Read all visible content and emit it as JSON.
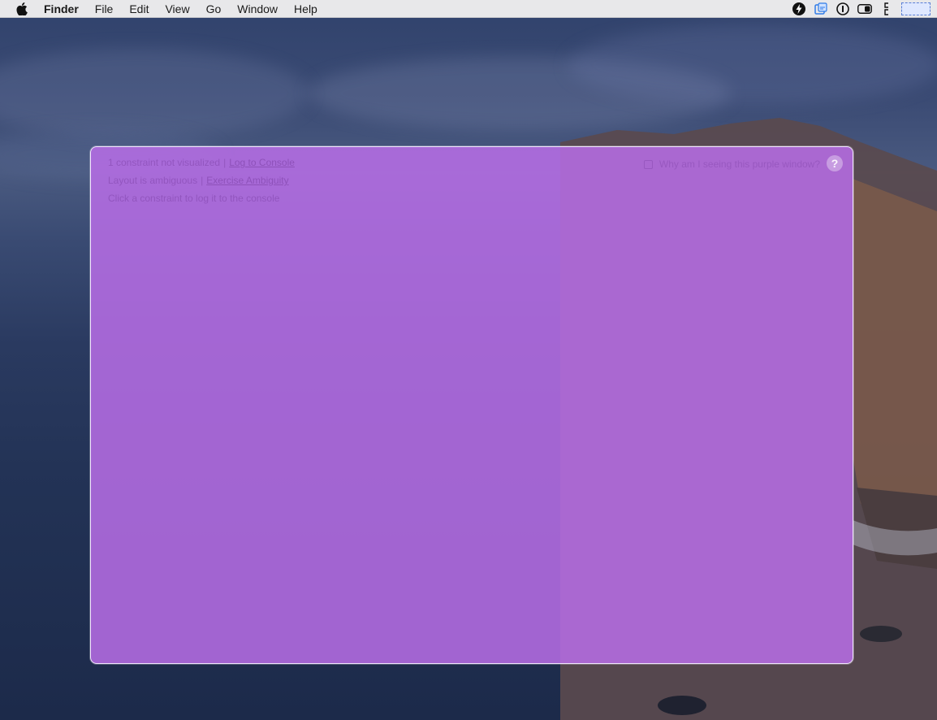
{
  "menubar": {
    "apple_icon": "apple-logo-icon",
    "app_name": "Finder",
    "items": [
      "File",
      "Edit",
      "View",
      "Go",
      "Window",
      "Help"
    ],
    "status_icons": [
      "lightning-icon",
      "window-screenshot-icon",
      "password-manager-icon",
      "toggle-icon",
      "clipboard-icon",
      "spotlight-field"
    ]
  },
  "overlay": {
    "color": "#b86ee6",
    "line1": {
      "text": "1 constraint not visualized",
      "link": "Log to Console"
    },
    "line2": {
      "text": "Layout is ambiguous",
      "link": "Exercise Ambiguity"
    },
    "line3": {
      "text": "Click a constraint to log it to the console"
    },
    "why_text": "Why am I seeing this purple window?",
    "help_label": "?"
  }
}
